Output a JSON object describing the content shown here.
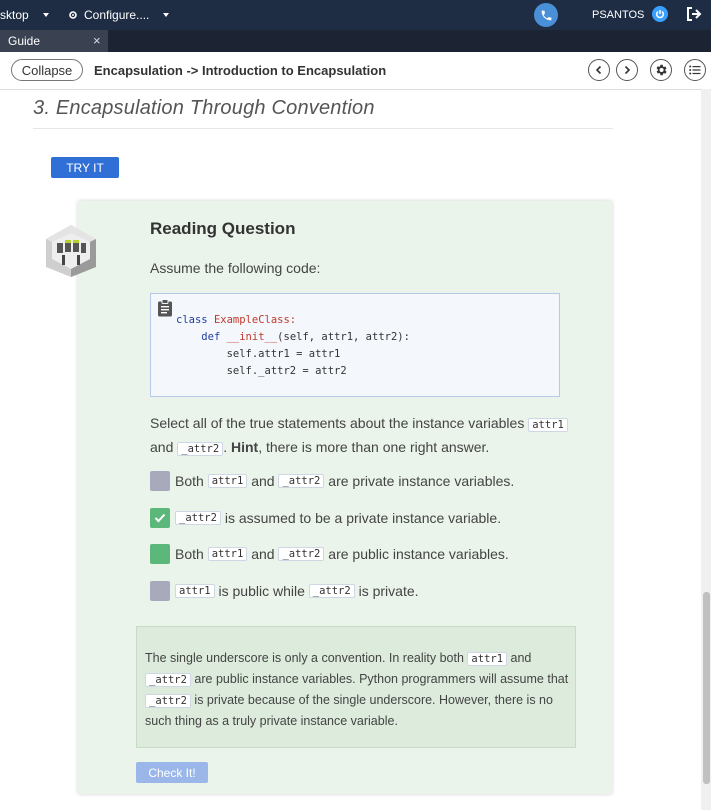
{
  "topbar": {
    "desktop_label": "sktop",
    "configure_label": "Configure....",
    "user": "PSANTOS"
  },
  "tabs": [
    {
      "label": "Guide",
      "close": "×"
    }
  ],
  "crumbbar": {
    "collapse_label": "Collapse",
    "breadcrumb": "Encapsulation -> Introduction to Encapsulation"
  },
  "content": {
    "section_title": "3. Encapsulation Through Convention",
    "try_it_label": "TRY IT"
  },
  "question": {
    "title": "Reading Question",
    "intro": "Assume the following code:",
    "code": {
      "line1_kw": "class",
      "line1_name": "ExampleClass:",
      "line2_kw": "def",
      "line2_name": "__init__",
      "line2_rest": "(self, attr1, attr2):",
      "line3": "self.attr1 = attr1",
      "line4": "self._attr2 = attr2"
    },
    "prompt_pre": "Select all of the true statements about the instance variables",
    "prompt_var1": "attr1",
    "prompt_and": "and",
    "prompt_var2": "_attr2",
    "prompt_hint": "Hint",
    "prompt_post": ", there is more than one right answer.",
    "options": [
      {
        "state": "unchecked",
        "t1": "Both",
        "c1": "attr1",
        "t2": "and",
        "c2": "_attr2",
        "t3": "are private instance variables."
      },
      {
        "state": "checked",
        "c1": "_attr2",
        "t1": "is assumed to be a private instance variable."
      },
      {
        "state": "unchecked-green",
        "t1": "Both",
        "c1": "attr1",
        "t2": "and",
        "c2": "_attr2",
        "t3": "are public instance variables."
      },
      {
        "state": "unchecked",
        "c1": "attr1",
        "t1": "is public while",
        "c2": "_attr2",
        "t2": "is private."
      }
    ],
    "feedback": {
      "p1": "The single underscore is only a convention. In reality both",
      "c1": "attr1",
      "p2": "and",
      "c2": "_attr2",
      "p3": "are public instance variables. Python programmers will assume that",
      "c3": "_attr2",
      "p4": "is private because of the single underscore. However, there is no such thing as a truly private instance variable."
    },
    "check_label": "Check It!"
  },
  "colors": {
    "topbar": "#1e2d44",
    "accent": "#2f6fd6",
    "card_bg": "#eaf4ea",
    "checkbox_green": "#5cb87a",
    "checkbox_grey": "#a9a9bd"
  },
  "icons": [
    "phone-icon",
    "power-icon",
    "logout-icon",
    "gear-icon",
    "chevron-left-icon",
    "chevron-right-icon",
    "list-icon",
    "clipboard-icon",
    "check-icon",
    "owl-logo-icon"
  ]
}
